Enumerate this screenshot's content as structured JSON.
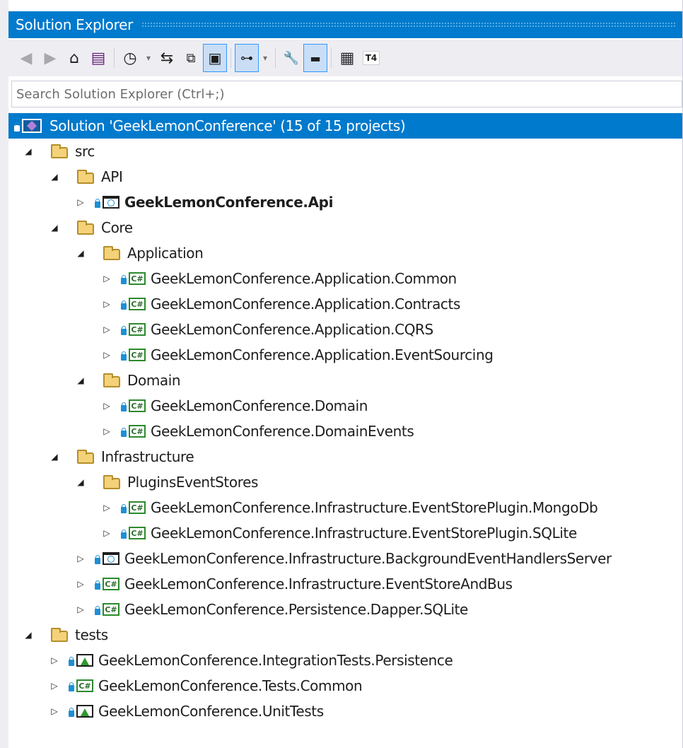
{
  "window": {
    "title": "Solution Explorer"
  },
  "toolbar": {
    "buttons": [
      {
        "icon": "back-icon",
        "glyph": "◀"
      },
      {
        "icon": "forward-icon",
        "glyph": "▶"
      },
      {
        "icon": "home-icon",
        "glyph": "⌂"
      },
      {
        "icon": "switch-views-icon",
        "glyph": "▤"
      },
      {
        "icon": "pending-changes-filter-icon",
        "glyph": "◷"
      },
      {
        "icon": "dropdown-arrow-icon",
        "glyph": "▾"
      },
      {
        "icon": "sync-with-active-document-icon",
        "glyph": "⇆"
      },
      {
        "icon": "collapse-all-icon",
        "glyph": "⧉"
      },
      {
        "icon": "show-all-files-icon",
        "glyph": "▣"
      },
      {
        "icon": "preview-selected-items-icon",
        "glyph": "⊶"
      },
      {
        "icon": "dropdown-arrow-icon",
        "glyph": "▾"
      },
      {
        "icon": "properties-wrench-icon",
        "glyph": "🔧"
      },
      {
        "icon": "preview-pane-icon",
        "glyph": "▬"
      },
      {
        "icon": "developer-console-icon",
        "glyph": "▦"
      },
      {
        "icon": "t4-template-icon",
        "glyph": "T4"
      }
    ]
  },
  "search": {
    "placeholder": "Search Solution Explorer (Ctrl+;)"
  },
  "tree": [
    {
      "label": "Solution 'GeekLemonConference' (15 of 15 projects)",
      "kind": "solution",
      "level": 0,
      "expanded": null,
      "selected": true
    },
    {
      "label": "src",
      "kind": "folder",
      "level": 0,
      "expanded": true
    },
    {
      "label": "API",
      "kind": "folder",
      "level": 1,
      "expanded": true
    },
    {
      "label": "GeekLemonConference.Api",
      "kind": "web",
      "level": 2,
      "expanded": false,
      "bold": true
    },
    {
      "label": "Core",
      "kind": "folder",
      "level": 1,
      "expanded": true
    },
    {
      "label": "Application",
      "kind": "folder",
      "level": 2,
      "expanded": true
    },
    {
      "label": "GeekLemonConference.Application.Common",
      "kind": "csharp",
      "level": 3,
      "expanded": false
    },
    {
      "label": "GeekLemonConference.Application.Contracts",
      "kind": "csharp",
      "level": 3,
      "expanded": false
    },
    {
      "label": "GeekLemonConference.Application.CQRS",
      "kind": "csharp",
      "level": 3,
      "expanded": false
    },
    {
      "label": "GeekLemonConference.Application.EventSourcing",
      "kind": "csharp",
      "level": 3,
      "expanded": false
    },
    {
      "label": "Domain",
      "kind": "folder",
      "level": 2,
      "expanded": true
    },
    {
      "label": "GeekLemonConference.Domain",
      "kind": "csharp",
      "level": 3,
      "expanded": false
    },
    {
      "label": "GeekLemonConference.DomainEvents",
      "kind": "csharp",
      "level": 3,
      "expanded": false
    },
    {
      "label": "Infrastructure",
      "kind": "folder",
      "level": 1,
      "expanded": true
    },
    {
      "label": "PluginsEventStores",
      "kind": "folder",
      "level": 2,
      "expanded": true
    },
    {
      "label": "GeekLemonConference.Infrastructure.EventStorePlugin.MongoDb",
      "kind": "csharp",
      "level": 3,
      "expanded": false
    },
    {
      "label": "GeekLemonConference.Infrastructure.EventStorePlugin.SQLite",
      "kind": "csharp",
      "level": 3,
      "expanded": false
    },
    {
      "label": "GeekLemonConference.Infrastructure.BackgroundEventHandlersServer",
      "kind": "web",
      "level": 2,
      "expanded": false
    },
    {
      "label": "GeekLemonConference.Infrastructure.EventStoreAndBus",
      "kind": "csharp",
      "level": 2,
      "expanded": false
    },
    {
      "label": "GeekLemonConference.Persistence.Dapper.SQLite",
      "kind": "csharp",
      "level": 2,
      "expanded": false
    },
    {
      "label": "tests",
      "kind": "folder",
      "level": 0,
      "expanded": true
    },
    {
      "label": "GeekLemonConference.IntegrationTests.Persistence",
      "kind": "test",
      "level": 1,
      "expanded": false
    },
    {
      "label": "GeekLemonConference.Tests.Common",
      "kind": "csharp",
      "level": 1,
      "expanded": false
    },
    {
      "label": "GeekLemonConference.UnitTests",
      "kind": "test",
      "level": 1,
      "expanded": false
    }
  ]
}
